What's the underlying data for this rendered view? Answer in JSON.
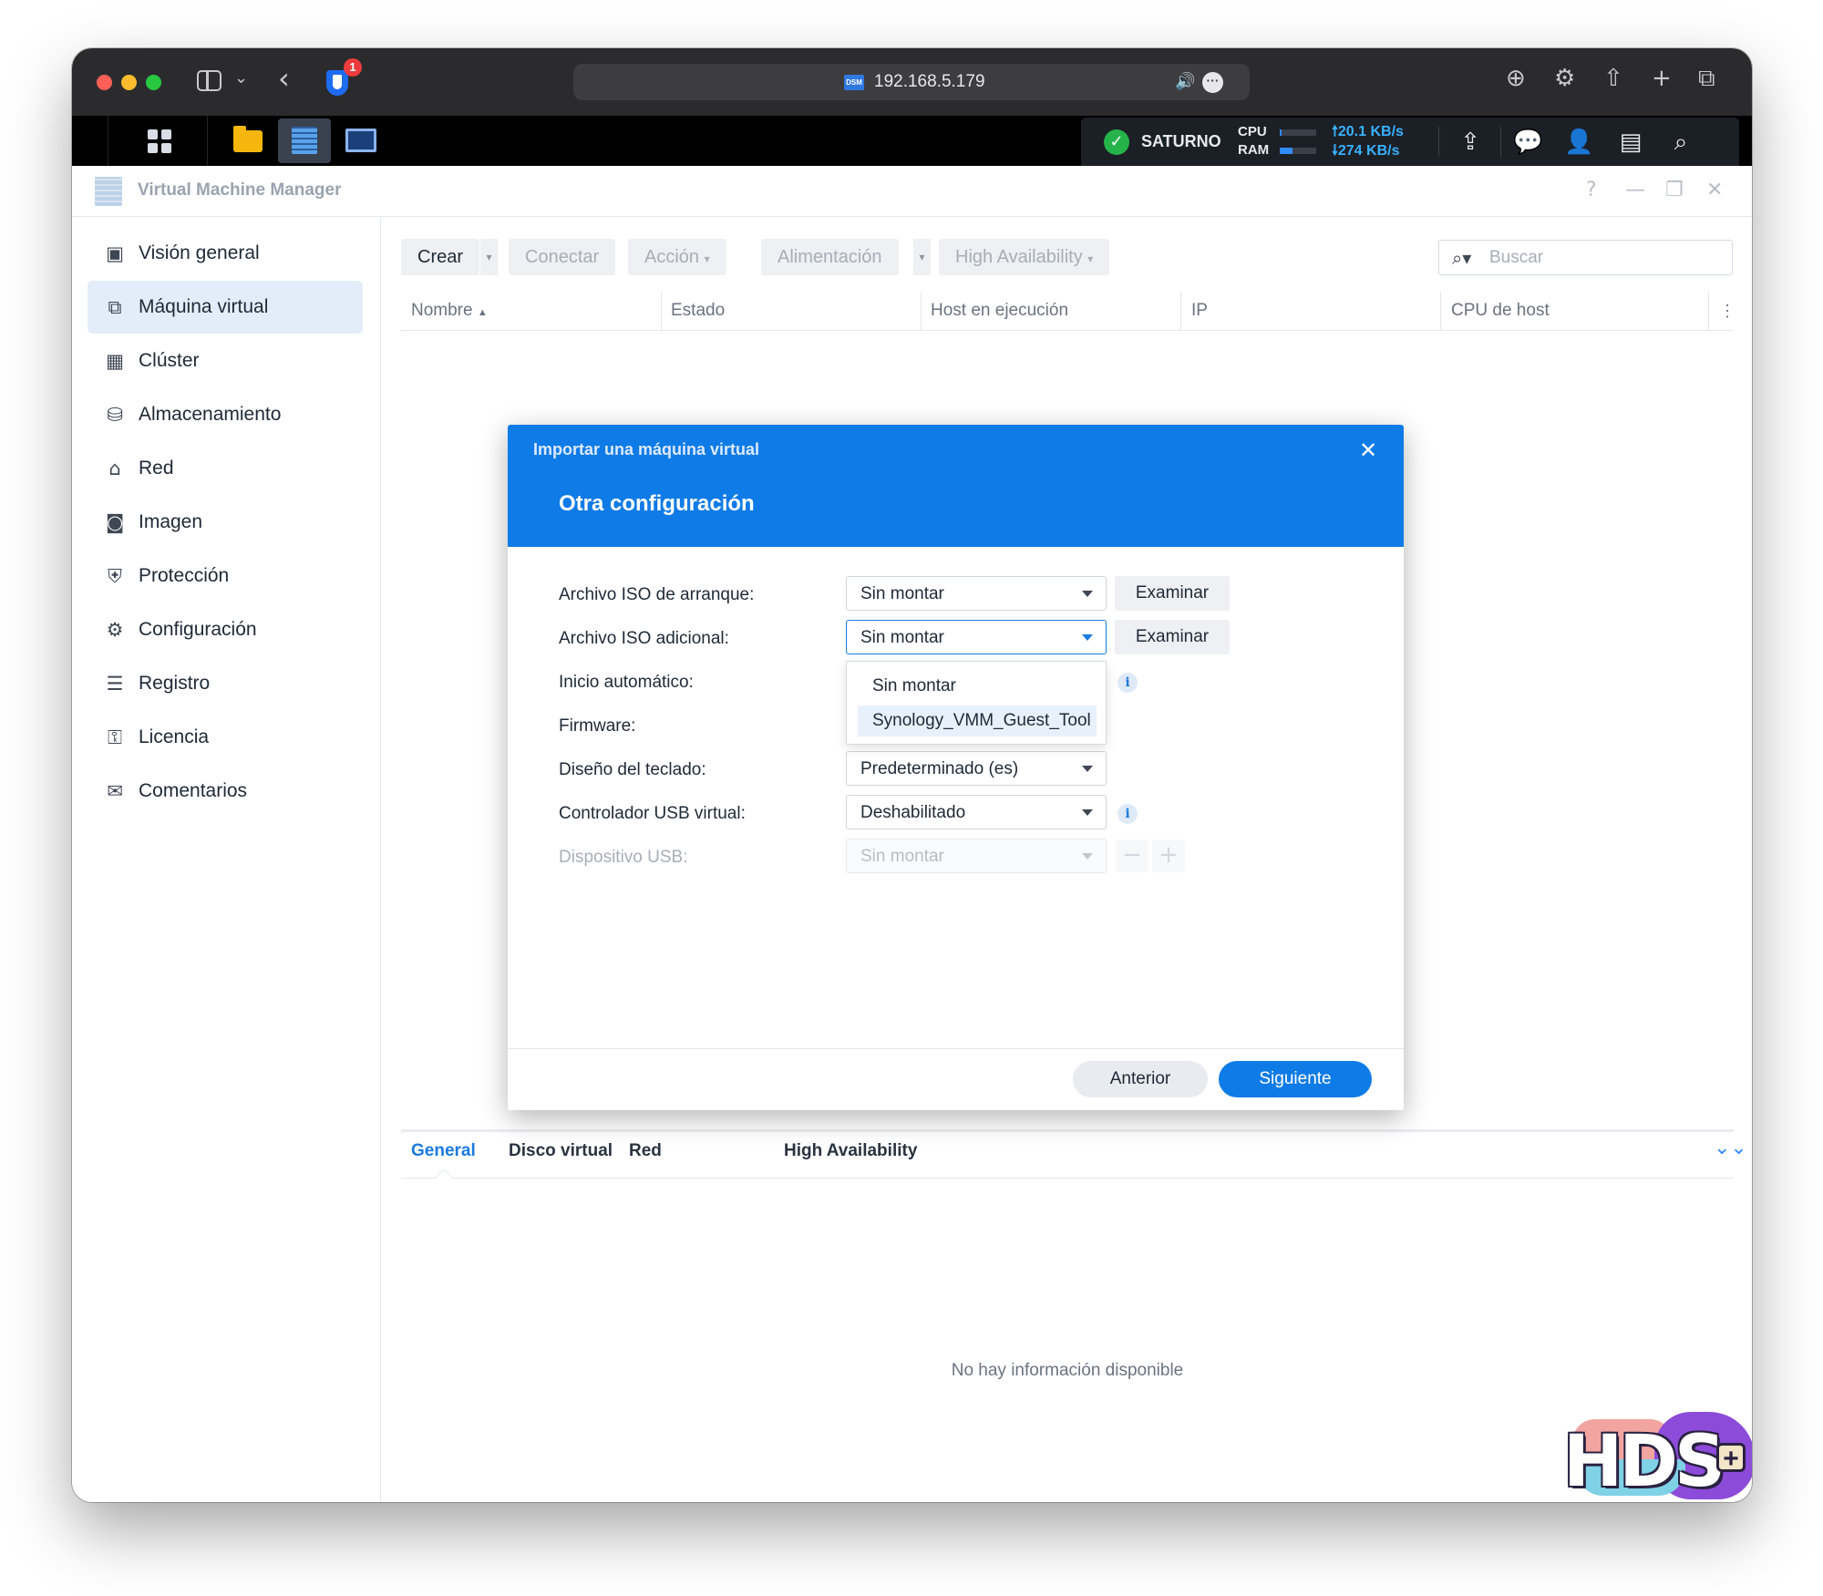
{
  "browser": {
    "url": "192.168.5.179",
    "favicon_label": "DSM",
    "extension_badge": "1"
  },
  "taskbar": {
    "hostname": "SATURNO",
    "cpu_label": "CPU",
    "ram_label": "RAM",
    "cpu_usage": 0.05,
    "ram_usage": 0.35,
    "upload": "20.1 KB/s",
    "download": "274 KB/s",
    "up_arrow": "🠕",
    "down_arrow": "🠗"
  },
  "app": {
    "title": "Virtual Machine Manager"
  },
  "sidebar": {
    "items": [
      {
        "label": "Visión general",
        "icon": "overview-icon"
      },
      {
        "label": "Máquina virtual",
        "icon": "virtual-machine-icon",
        "active": true
      },
      {
        "label": "Clúster",
        "icon": "cluster-icon"
      },
      {
        "label": "Almacenamiento",
        "icon": "storage-icon"
      },
      {
        "label": "Red",
        "icon": "network-icon"
      },
      {
        "label": "Imagen",
        "icon": "image-icon"
      },
      {
        "label": "Protección",
        "icon": "shield-icon"
      },
      {
        "label": "Configuración",
        "icon": "gear-icon"
      },
      {
        "label": "Registro",
        "icon": "list-icon"
      },
      {
        "label": "Licencia",
        "icon": "key-icon"
      },
      {
        "label": "Comentarios",
        "icon": "mail-icon"
      }
    ]
  },
  "toolbar": {
    "create": "Crear",
    "connect": "Conectar",
    "action": "Acción",
    "power": "Alimentación",
    "ha": "High Availability",
    "search_placeholder": "Buscar"
  },
  "table": {
    "columns": [
      "Nombre",
      "Estado",
      "Host en ejecución",
      "IP",
      "CPU de host"
    ]
  },
  "bottom_tabs": {
    "tabs": [
      "General",
      "Disco virtual",
      "Red",
      "High Availability"
    ],
    "active": "General",
    "empty_text": "No hay información disponible"
  },
  "dialog": {
    "caption": "Importar una máquina virtual",
    "title": "Otra configuración",
    "fields": {
      "boot_iso": {
        "label": "Archivo ISO de arranque:",
        "value": "Sin montar"
      },
      "extra_iso": {
        "label": "Archivo ISO adicional:",
        "value": "Sin montar"
      },
      "autostart": {
        "label": "Inicio automático:"
      },
      "firmware": {
        "label": "Firmware:"
      },
      "keyboard": {
        "label": "Diseño del teclado:",
        "value": "Predeterminado (es)"
      },
      "usb_ctrl": {
        "label": "Controlador USB virtual:",
        "value": "Deshabilitado"
      },
      "usb_dev": {
        "label": "Dispositivo USB:",
        "value": "Sin montar"
      }
    },
    "browse_label": "Examinar",
    "dropdown_options": [
      "Sin montar",
      "Synology_VMM_Guest_Tool"
    ],
    "info_glyph": "i",
    "prev": "Anterior",
    "next": "Siguiente"
  },
  "watermark": {
    "text": "HDS",
    "plus": "+"
  }
}
